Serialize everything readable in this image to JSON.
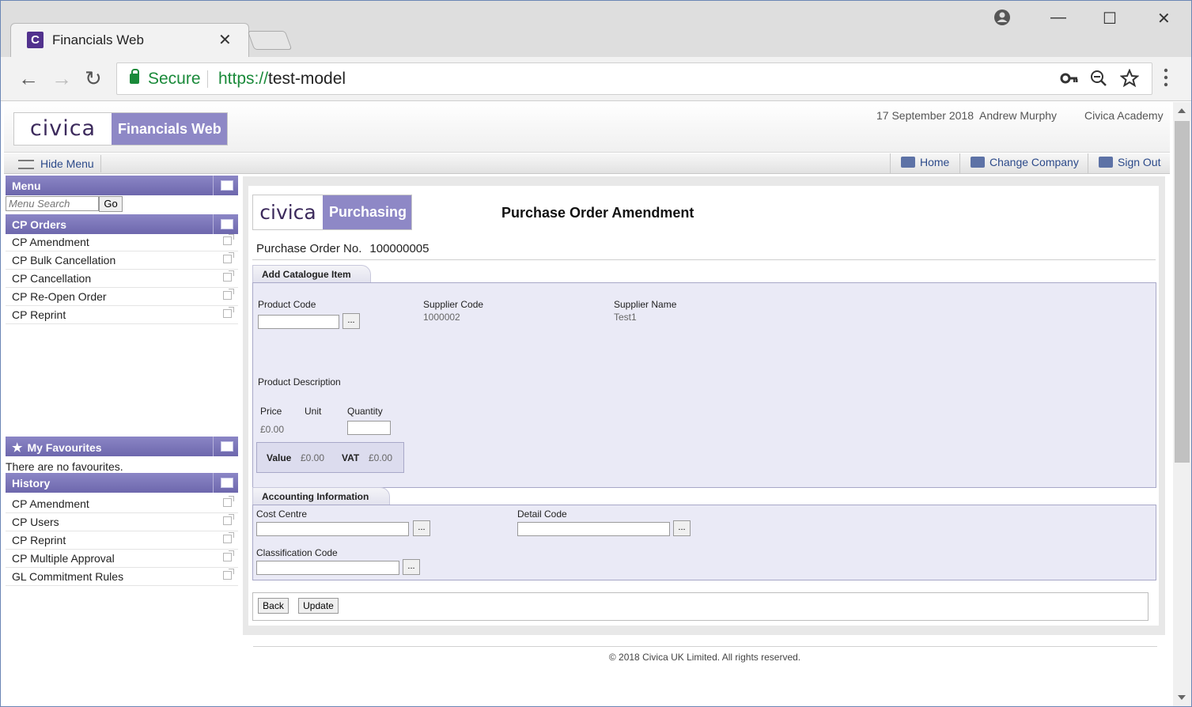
{
  "browser": {
    "tab_title": "Financials Web",
    "tab_close": "✕",
    "favicon_letter": "C",
    "secure_label": "Secure",
    "url_scheme": "https://",
    "url_host": "test-model",
    "nav": {
      "back": "←",
      "forward": "→",
      "reload": "↻"
    },
    "icons": {
      "account": "account-circle-icon",
      "key": "key-icon",
      "zoom": "zoom-out-icon",
      "bookmark": "star-icon",
      "menu": "more-vert-icon"
    },
    "window_controls": {
      "minimize": "—",
      "maximize": "☐",
      "close": "✕"
    }
  },
  "header": {
    "logo_brand": "civica",
    "logo_product": "Financials Web",
    "date": "17 September 2018",
    "user": "Andrew Murphy",
    "organisation": "Civica Academy"
  },
  "topnav": {
    "hide_menu": "Hide Menu",
    "home": "Home",
    "change_company": "Change Company",
    "sign_out": "Sign Out"
  },
  "sidebar": {
    "menu_title": "Menu",
    "search_placeholder": "Menu Search",
    "go_label": "Go",
    "orders_title": "CP Orders",
    "orders_items": [
      "CP Amendment",
      "CP Bulk Cancellation",
      "CP Cancellation",
      "CP Re-Open Order",
      "CP Reprint"
    ],
    "favourites_title": "My Favourites",
    "favourites_empty": "There are no favourites.",
    "history_title": "History",
    "history_items": [
      "CP Amendment",
      "CP Users",
      "CP Reprint",
      "CP Multiple Approval",
      "GL Commitment Rules"
    ]
  },
  "page": {
    "logo_brand": "civica",
    "logo_product": "Purchasing",
    "title": "Purchase Order Amendment",
    "po_label": "Purchase Order No.",
    "po_number": "100000005"
  },
  "catalogue": {
    "section_title": "Add Catalogue Item",
    "product_code_label": "Product Code",
    "supplier_code_label": "Supplier Code",
    "supplier_code_value": "1000002",
    "supplier_name_label": "Supplier Name",
    "supplier_name_value": "Test1",
    "product_description_label": "Product Description",
    "price_label": "Price",
    "price_value": "£0.00",
    "unit_label": "Unit",
    "quantity_label": "Quantity",
    "value_label": "Value",
    "value_value": "£0.00",
    "vat_label": "VAT",
    "vat_value": "£0.00",
    "lookup_label": "..."
  },
  "accounting": {
    "section_title": "Accounting Information",
    "cost_centre_label": "Cost Centre",
    "detail_code_label": "Detail Code",
    "classification_code_label": "Classification Code",
    "lookup_label": "..."
  },
  "actions": {
    "back": "Back",
    "update": "Update"
  },
  "footer": {
    "copyright": "© 2018 Civica UK Limited. All rights reserved."
  }
}
